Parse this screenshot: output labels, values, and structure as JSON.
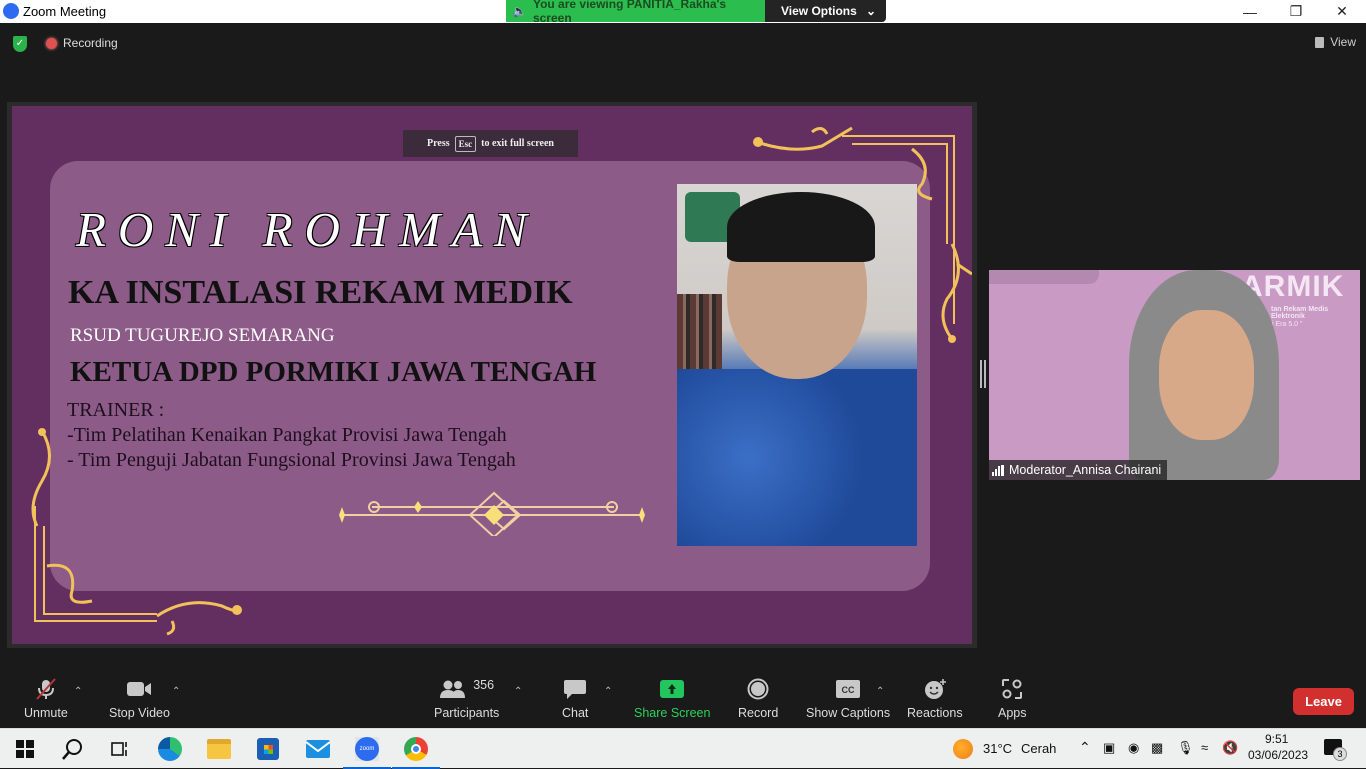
{
  "window": {
    "title": "Zoom Meeting",
    "minimize_icon": "minimize-icon",
    "restore_icon": "restore-icon",
    "close_icon": "close-icon"
  },
  "banner": {
    "viewing_text": "You are viewing PANITIA_Rakha's screen",
    "view_options_label": "View Options"
  },
  "topbar": {
    "recording_label": "Recording",
    "view_label": "View"
  },
  "share": {
    "esc_hint_prefix": "Press",
    "esc_key": "Esc",
    "esc_hint_suffix": "to exit full screen",
    "slide": {
      "name": "RONI ROHMAN",
      "title1": "KA INSTALASI REKAM MEDIK",
      "org": "RSUD TUGUREJO SEMARANG",
      "title2": "KETUA DPD PORMIKI JAWA TENGAH",
      "trainer_heading": "TRAINER :",
      "trainer_items": [
        "-Tim Pelatihan Kenaikan Pangkat Provisi Jawa Tengah",
        "- Tim Penguji Jabatan Fungsional Provinsi Jawa Tengah"
      ],
      "colors": {
        "background": "#632f60",
        "panel": "#8c5b88",
        "ornament": "#f2c15a"
      }
    }
  },
  "video": {
    "participant_name": "Moderator_Annisa Chairani",
    "background_text": "ARMIK",
    "background_subtext": "tan Rekam Medis Elektronik",
    "background_subtext2": "i Era 5.0 \""
  },
  "toolbar": {
    "items": [
      {
        "label": "Unmute",
        "icon": "microphone-muted-icon"
      },
      {
        "label": "Stop Video",
        "icon": "video-camera-icon"
      },
      {
        "label": "Participants",
        "icon": "participants-icon",
        "count": "356"
      },
      {
        "label": "Chat",
        "icon": "chat-icon"
      },
      {
        "label": "Share Screen",
        "icon": "share-screen-icon"
      },
      {
        "label": "Record",
        "icon": "record-icon"
      },
      {
        "label": "Show Captions",
        "icon": "cc-icon"
      },
      {
        "label": "Reactions",
        "icon": "reactions-icon"
      },
      {
        "label": "Apps",
        "icon": "apps-icon"
      }
    ],
    "leave_label": "Leave",
    "share_color": "#22c55e",
    "leave_color": "#d1302e"
  },
  "taskbar": {
    "weather_temp": "31°C",
    "weather_desc": "Cerah",
    "time": "9:51",
    "date": "03/06/2023",
    "notification_count": "3"
  }
}
